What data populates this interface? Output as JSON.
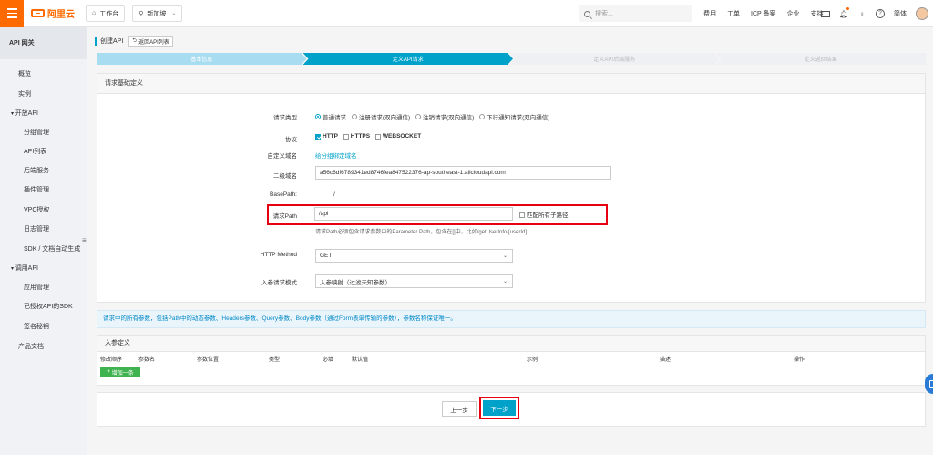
{
  "topbar": {
    "logo_text": "阿里云",
    "workbench": "工作台",
    "region": "新加坡",
    "search_placeholder": "搜索...",
    "links": [
      "费用",
      "工单",
      "ICP 备案",
      "企业",
      "支持"
    ],
    "lang": "简体"
  },
  "sidebar": {
    "title": "API 网关",
    "items": [
      {
        "label": "概览",
        "indent": 1
      },
      {
        "label": "实例",
        "indent": 1
      },
      {
        "label": "开放API",
        "indent": 0,
        "group": true
      },
      {
        "label": "分组管理",
        "indent": 2
      },
      {
        "label": "API列表",
        "indent": 2
      },
      {
        "label": "后端服务",
        "indent": 2
      },
      {
        "label": "插件管理",
        "indent": 2
      },
      {
        "label": "VPC授权",
        "indent": 2
      },
      {
        "label": "日志管理",
        "indent": 2
      },
      {
        "label": "SDK / 文档自动生成",
        "indent": 2
      },
      {
        "label": "调用API",
        "indent": 0,
        "group": true
      },
      {
        "label": "应用管理",
        "indent": 2
      },
      {
        "label": "已授权API的SDK",
        "indent": 2
      },
      {
        "label": "签名秘钥",
        "indent": 2
      },
      {
        "label": "产品文档",
        "indent": 1
      }
    ]
  },
  "header": {
    "title": "创建API",
    "back_label": "返回API列表"
  },
  "steps": [
    "基本信息",
    "定义API请求",
    "定义API后端服务",
    "定义返回结果"
  ],
  "section": {
    "title": "请求基础定义"
  },
  "form": {
    "request_type_label": "请求类型",
    "request_types": [
      "普通请求",
      "注册请求(双向通信)",
      "注销请求(双向通信)",
      "下行通知请求(双向通信)"
    ],
    "protocol_label": "协议",
    "protocols": [
      "HTTP",
      "HTTPS",
      "WEBSOCKET"
    ],
    "custom_domain_label": "自定义域名",
    "custom_domain_link": "给分组绑定域名",
    "subdomain_label": "二级域名",
    "subdomain_value": "a56c6df6789341ed8746fea847522376-ap-southeast-1.alicloudapi.com",
    "basepath_label": "BasePath:",
    "basepath_value": "/",
    "path_label": "请求Path",
    "path_value": "/api",
    "match_all_label": "匹配所有子路径",
    "path_hint": "请求Path必须包含请求参数中的Parameter Path，包含在[]中，比如/getUserInfo/[userId]",
    "method_label": "HTTP Method",
    "method_value": "GET",
    "mode_label": "入参请求模式",
    "mode_value": "入参映射（过滤未知参数）"
  },
  "notice": "请求中的所有参数，包括Path中的动态参数、Headers参数、Query参数、Body参数（通过Form表单传输的参数），参数名称保证唯一。",
  "params": {
    "title": "入参定义",
    "columns": [
      "修改顺序",
      "参数名",
      "参数位置",
      "类型",
      "必填",
      "默认值",
      "示例",
      "描述",
      "操作"
    ],
    "add_label": "增加一条"
  },
  "footer": {
    "prev_label": "上一步",
    "next_label": "下一步"
  },
  "colors": {
    "brand": "#ff6a00",
    "primary": "#00a2ca",
    "highlight": "#e60012",
    "add": "#3fb34f"
  }
}
